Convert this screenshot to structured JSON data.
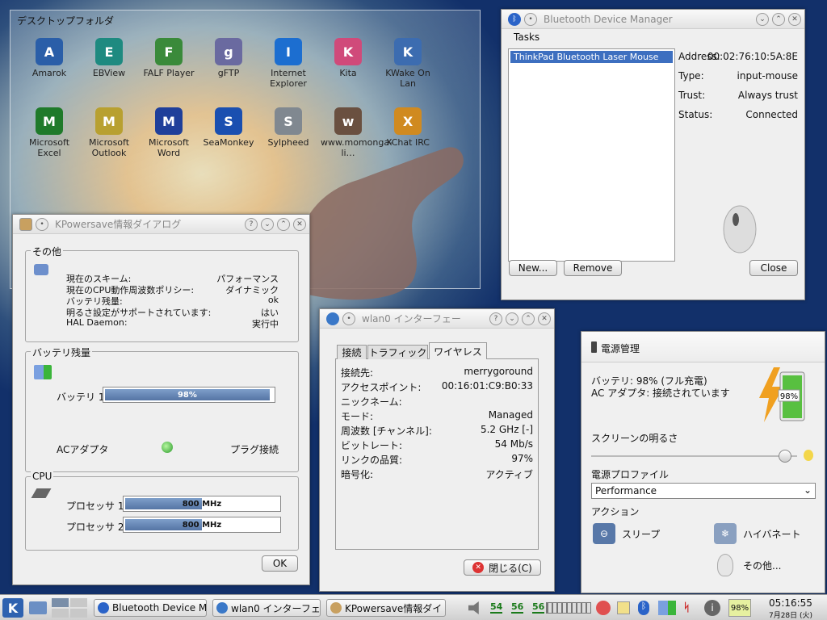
{
  "desktop_folder": {
    "title": "デスクトップフォルダ",
    "icons": [
      {
        "label": "Amarok",
        "icon": "amarok-icon",
        "color": "#2a5ea8"
      },
      {
        "label": "EBView",
        "icon": "ebview-icon",
        "color": "#1e8a80"
      },
      {
        "label": "FALF Player",
        "icon": "falf-icon",
        "color": "#3a8a3a"
      },
      {
        "label": "gFTP",
        "icon": "gftp-icon",
        "color": "#6a6aa0"
      },
      {
        "label": "Internet Explorer",
        "icon": "ie-icon",
        "color": "#1c6ed0"
      },
      {
        "label": "Kita",
        "icon": "kita-icon",
        "color": "#d04a7a"
      },
      {
        "label": "KWake On Lan",
        "icon": "kwake-icon",
        "color": "#3c6cb0"
      },
      {
        "label": "Microsoft Excel",
        "icon": "excel-icon",
        "color": "#1f7a2a"
      },
      {
        "label": "Microsoft Outlook",
        "icon": "outlook-icon",
        "color": "#b8a030"
      },
      {
        "label": "Microsoft Word",
        "icon": "word-icon",
        "color": "#1f3f9a"
      },
      {
        "label": "SeaMonkey",
        "icon": "seamonkey-icon",
        "color": "#1a4fb0"
      },
      {
        "label": "Sylpheed",
        "icon": "sylpheed-icon",
        "color": "#808890"
      },
      {
        "label": "www.momonga-li…",
        "icon": "momonga-icon",
        "color": "#6a5040"
      },
      {
        "label": "XChat IRC",
        "icon": "xchat-icon",
        "color": "#d08a20"
      }
    ]
  },
  "bt": {
    "title": "Bluetooth Device Manager",
    "menu": "Tasks",
    "device": "ThinkPad Bluetooth Laser Mouse",
    "props": [
      {
        "k": "Address:",
        "v": "00:02:76:10:5A:8E"
      },
      {
        "k": "Type:",
        "v": "input-mouse"
      },
      {
        "k": "Trust:",
        "v": "Always trust"
      },
      {
        "k": "Status:",
        "v": "Connected"
      }
    ],
    "new": "New...",
    "remove": "Remove",
    "close": "Close"
  },
  "kp": {
    "title": "KPowersave情報ダイアログ",
    "other_title": "その他",
    "other": [
      {
        "k": "現在のスキーム:",
        "v": "パフォーマンス"
      },
      {
        "k": "現在のCPU動作周波数ポリシー:",
        "v": "ダイナミック"
      },
      {
        "k": "バッテリ残量:",
        "v": "ok"
      },
      {
        "k": "明るさ設定がサポートされています:",
        "v": "はい"
      },
      {
        "k": "HAL Daemon:",
        "v": "実行中"
      }
    ],
    "bat_title": "バッテリ残量",
    "bat_label": "バッテリ 1",
    "bat_value": "98%",
    "bat_pct": 98,
    "ac_label": "ACアダプタ",
    "ac_status": "プラグ接続",
    "cpu_title": "CPU",
    "cpus": [
      {
        "label": "プロセッサ 1",
        "value": "800 MHz",
        "pct": 50
      },
      {
        "label": "プロセッサ 2",
        "value": "800 MHz",
        "pct": 50
      }
    ],
    "ok": "OK"
  },
  "wl": {
    "title": "wlan0 インターフェー",
    "tabs": [
      "接続",
      "トラフィック",
      "ワイヤレス"
    ],
    "props": [
      {
        "k": "接続先:",
        "v": "merrygoround"
      },
      {
        "k": "アクセスポイント:",
        "v": "00:16:01:C9:B0:33"
      },
      {
        "k": "ニックネーム:",
        "v": ""
      },
      {
        "k": "モード:",
        "v": "Managed"
      },
      {
        "k": "周波数 [チャンネル]:",
        "v": "5.2 GHz [-]"
      },
      {
        "k": "ビットレート:",
        "v": "54 Mb/s"
      },
      {
        "k": "リンクの品質:",
        "v": "97%"
      },
      {
        "k": "暗号化:",
        "v": "アクティブ"
      }
    ],
    "close": "閉じる(C)"
  },
  "pm": {
    "title": "電源管理",
    "battery": "バッテリ: 98% (フル充電)",
    "ac": "AC アダプタ: 接続されています",
    "bat_badge": "98%",
    "brightness": "スクリーンの明るさ",
    "brightness_level": 0.94,
    "profile_label": "電源プロファイル",
    "profile": "Performance",
    "actions_label": "アクション",
    "sleep": "スリープ",
    "hibernate": "ハイバネート",
    "other": "その他..."
  },
  "taskbar": {
    "tasks": [
      "Bluetooth Device M",
      "wlan0 インターフェー",
      "KPowersave情報ダイ"
    ],
    "tray_nums": [
      "54",
      "56",
      "56"
    ],
    "battery": "98%",
    "time": "05:16:55",
    "date": "7月28日 (火)"
  }
}
